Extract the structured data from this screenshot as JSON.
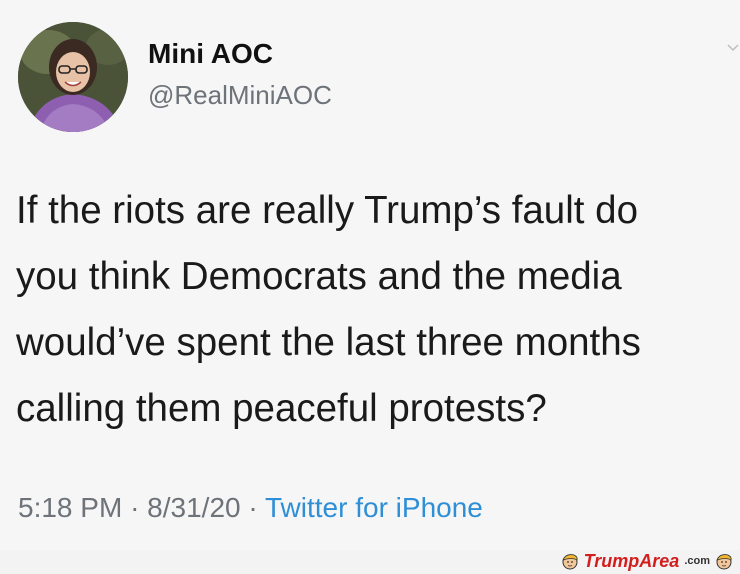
{
  "tweet": {
    "display_name": "Mini AOC",
    "handle": "@RealMiniAOC",
    "text_lines": [
      "If the riots are really Trump’s fault do",
      "you think Democrats and the media",
      "would’ve spent the last three months",
      "calling them peaceful protests?"
    ],
    "time": "5:18 PM",
    "separator": "·",
    "date": "8/31/20",
    "source": "Twitter for iPhone"
  },
  "watermark": {
    "brand_part1": "Trump",
    "brand_part2": "Area",
    "suffix": ".com"
  },
  "colors": {
    "handle": "#6d7379",
    "source_link": "#2f8fd6",
    "watermark": "#d31e1e"
  }
}
